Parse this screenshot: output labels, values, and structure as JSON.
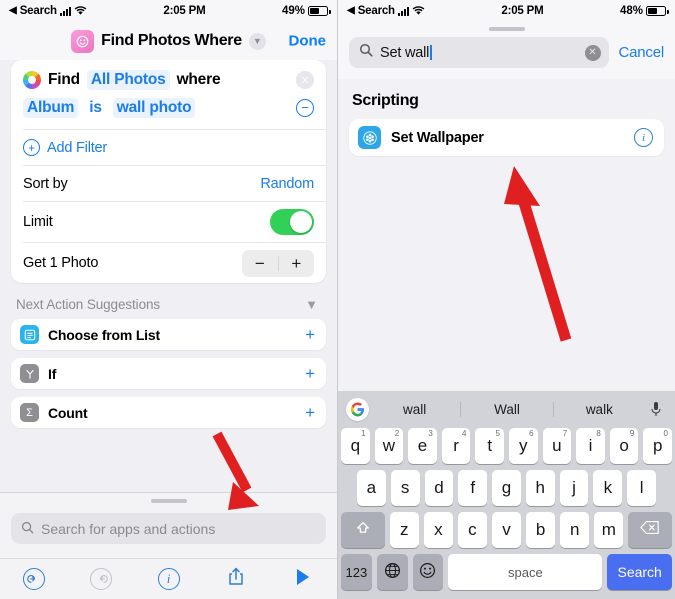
{
  "left": {
    "statusbar": {
      "back_label": "Search",
      "time": "2:05 PM",
      "battery_pct": "49%"
    },
    "header": {
      "icon": "shortcuts-photos-icon",
      "title": "Find Photos Where",
      "chevron": "chevron-down-icon",
      "done_label": "Done"
    },
    "action_card": {
      "find_label": "Find",
      "source_token": "All Photos",
      "where_label": "where",
      "clear_icon": "clear-circle-icon",
      "condition": {
        "field": "Album",
        "operator": "is",
        "value": "wall photo",
        "remove_icon": "minus-circle-icon"
      },
      "add_filter_label": "Add Filter",
      "rows": [
        {
          "label": "Sort by",
          "value": "Random",
          "control": "value"
        },
        {
          "label": "Limit",
          "value": "",
          "control": "toggle-on"
        },
        {
          "label": "Get 1 Photo",
          "value": "",
          "control": "stepper",
          "minus": "−",
          "plus": "+"
        }
      ]
    },
    "suggestions": {
      "title": "Next Action Suggestions",
      "collapse_icon": "chevron-down-icon",
      "items": [
        {
          "label": "Choose from List",
          "icon": "list-icon",
          "icon_color": "blue",
          "add": "+"
        },
        {
          "label": "If",
          "icon": "if-branch-icon",
          "icon_color": "gray",
          "add": "+"
        },
        {
          "label": "Count",
          "icon": "sigma-count-icon",
          "icon_color": "gray",
          "add": "+"
        }
      ]
    },
    "bottom_sheet": {
      "search_placeholder": "Search for apps and actions",
      "search_icon": "search-icon"
    },
    "toolbar": [
      {
        "name": "undo-icon",
        "glyph": "↺",
        "enabled": true
      },
      {
        "name": "redo-icon",
        "glyph": "↻",
        "enabled": false
      },
      {
        "name": "info-icon",
        "glyph": "i",
        "enabled": true
      },
      {
        "name": "share-icon",
        "glyph": "↑",
        "enabled": true
      },
      {
        "name": "play-icon",
        "glyph": "▶",
        "enabled": true
      }
    ]
  },
  "right": {
    "statusbar": {
      "back_label": "Search",
      "time": "2:05 PM",
      "battery_pct": "48%"
    },
    "search": {
      "icon": "search-icon",
      "value": "Set wall",
      "clear_icon": "clear-circle-icon",
      "cancel_label": "Cancel"
    },
    "results": {
      "section_title": "Scripting",
      "items": [
        {
          "label": "Set Wallpaper",
          "icon": "set-wallpaper-icon",
          "info_icon": "info-icon"
        }
      ]
    },
    "keyboard": {
      "assistant_icon": "google-logo-icon",
      "suggestions": [
        "wall",
        "Wall",
        "walk"
      ],
      "mic_icon": "microphone-icon",
      "row1": [
        {
          "k": "q",
          "n": "1"
        },
        {
          "k": "w",
          "n": "2"
        },
        {
          "k": "e",
          "n": "3"
        },
        {
          "k": "r",
          "n": "4"
        },
        {
          "k": "t",
          "n": "5"
        },
        {
          "k": "y",
          "n": "6"
        },
        {
          "k": "u",
          "n": "7"
        },
        {
          "k": "i",
          "n": "8"
        },
        {
          "k": "o",
          "n": "9"
        },
        {
          "k": "p",
          "n": "0"
        }
      ],
      "row2": [
        "a",
        "s",
        "d",
        "f",
        "g",
        "h",
        "j",
        "k",
        "l"
      ],
      "row3": [
        "z",
        "x",
        "c",
        "v",
        "b",
        "n",
        "m"
      ],
      "shift_icon": "shift-up-icon",
      "backspace_icon": "backspace-icon",
      "num_key_label": "123",
      "globe_icon": "globe-language-icon",
      "emoji_icon": "emoji-smiley-icon",
      "space_label": "space",
      "search_key_label": "Search"
    }
  },
  "annotations": {
    "arrow_left": "red-arrow-pointing-to-search-field",
    "arrow_right": "red-arrow-pointing-to-set-wallpaper"
  },
  "colors": {
    "accent_blue": "#1b7ced",
    "toggle_green": "#31d158",
    "arrow_red": "#e02020",
    "keyboard_bg": "#d1d3d9",
    "search_key_blue": "#4a6ef0"
  }
}
